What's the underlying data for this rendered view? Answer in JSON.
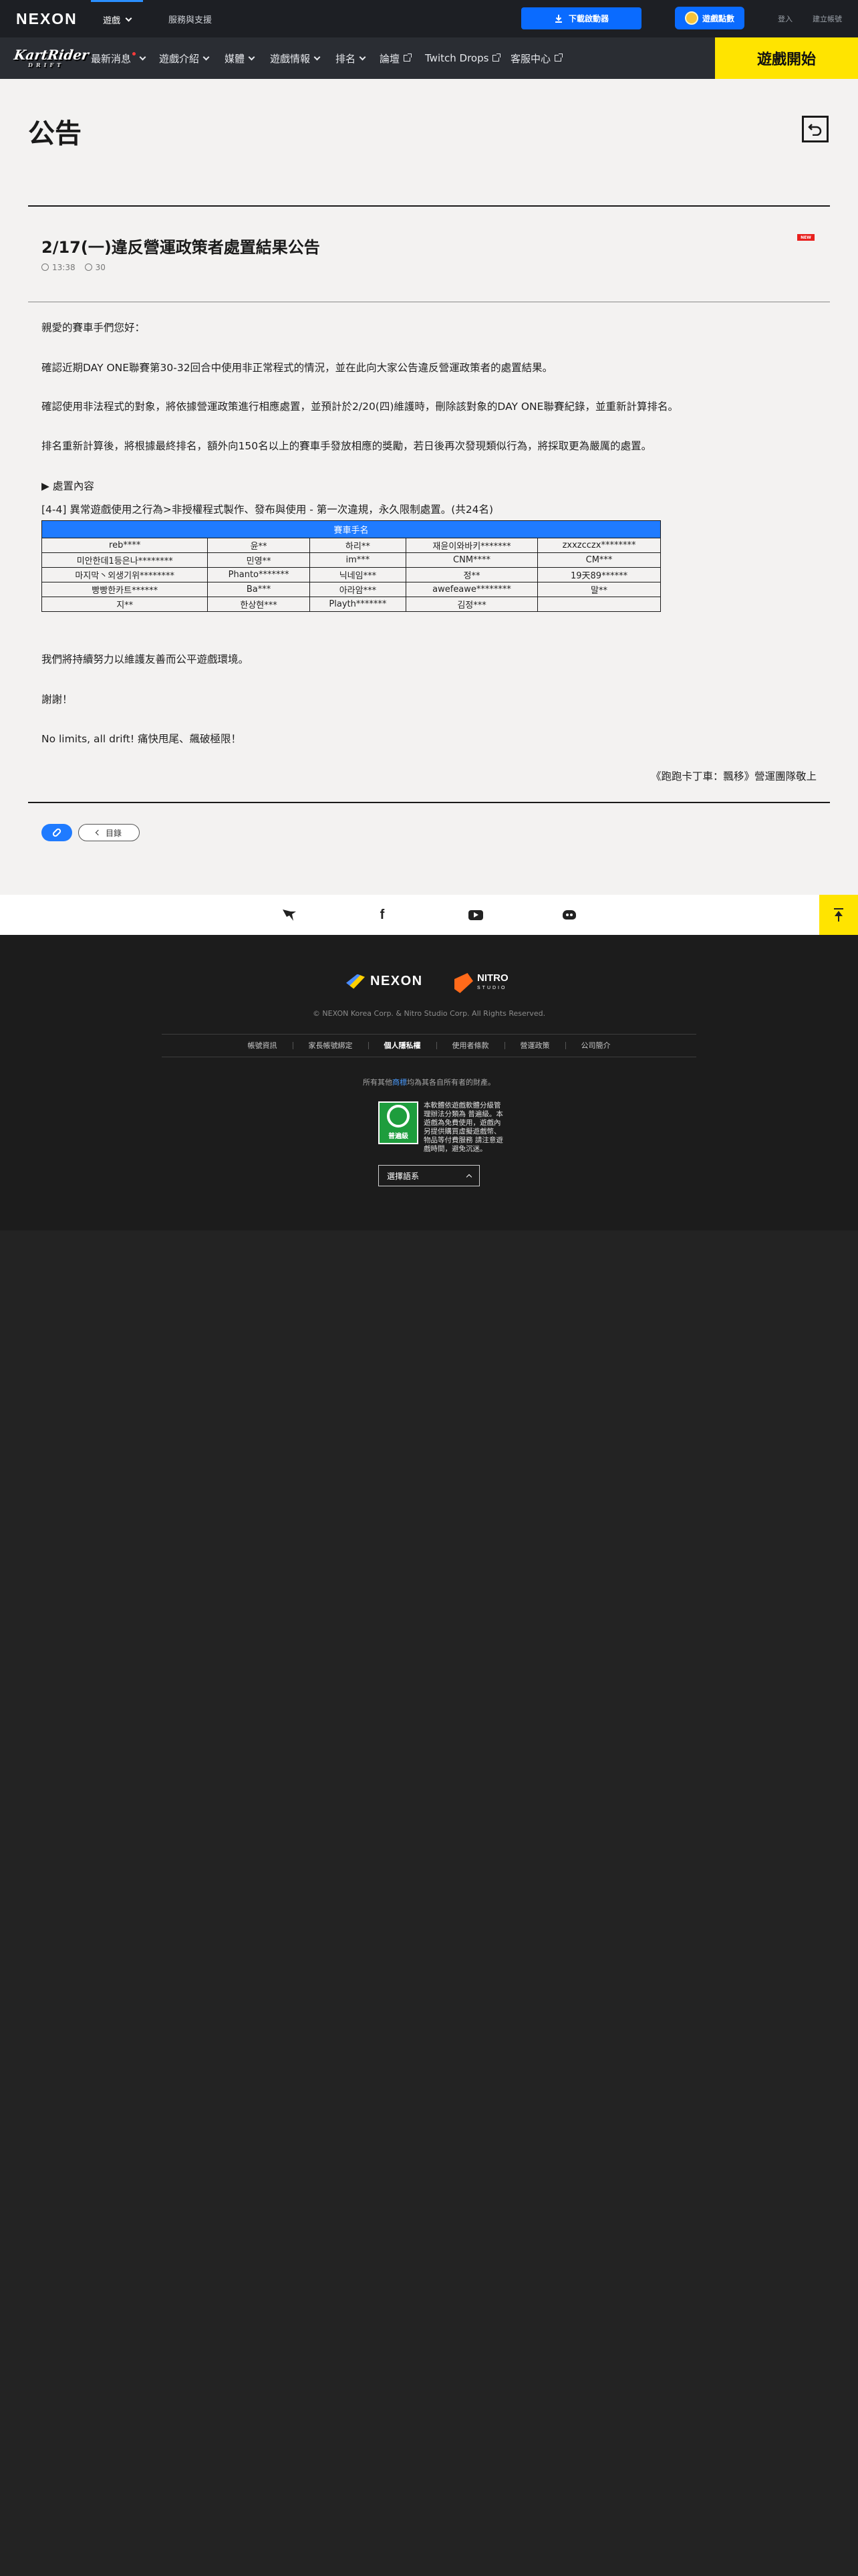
{
  "topbar": {
    "logo": "NEXON",
    "nav": [
      {
        "label": "遊戲"
      },
      {
        "label": "服務與支援"
      }
    ],
    "download_label": "下載啟動器",
    "gameplay_label": "遊戲點數",
    "login_label": "登入",
    "register_label": "建立帳號"
  },
  "gamenav": {
    "logo_main": "KartRider",
    "logo_sub": "DRIFT",
    "items": [
      {
        "label": "最新消息"
      },
      {
        "label": "遊戲介紹"
      },
      {
        "label": "媒體"
      },
      {
        "label": "遊戲情報"
      },
      {
        "label": "排名"
      },
      {
        "label": "論壇"
      },
      {
        "label": "Twitch Drops"
      },
      {
        "label": "客服中心"
      }
    ],
    "start_label": "遊戲開始"
  },
  "page": {
    "title": "公告",
    "back_icon": "return-icon"
  },
  "post": {
    "title": "2/17(一)違反營運政策者處置結果公告",
    "time": "13:38",
    "views": "30",
    "badge": "NEW",
    "greeting": "親愛的賽車手們您好：",
    "p1": "確認近期DAY ONE聯賽第30-32回合中使用非正常程式的情況，並在此向大家公告違反營運政策者的處置結果。",
    "p2": "確認使用非法程式的對象，將依據營運政策進行相應處置，並預計於2/20(四)維護時，刪除該對象的DAY ONE聯賽紀錄，並重新計算排名。",
    "p3": "排名重新計算後，將根據最終排名，額外向150名以上的賽車手發放相應的獎勵，若日後再次發現類似行為，將採取更為嚴厲的處置。",
    "section_label": "▶ 處置內容",
    "rule_line": "[4-4] 異常遊戲使用之行為>非授權程式製作、發布與使用 - 第一次違規，永久限制處置。(共24名)",
    "table": {
      "header": "賽車手名",
      "rows": [
        [
          "reb****",
          "윤**",
          "하리**",
          "재윤이와바키*******",
          "zxxzcczx********"
        ],
        [
          "미안한데1등은나********",
          "민영**",
          "im***",
          "CNM****",
          "CM***"
        ],
        [
          "마지막丶외생기위********",
          "Phanto*******",
          "닉네임***",
          "정**",
          "19天89******"
        ],
        [
          "빵빵한카트******",
          "Ba***",
          "아라암***",
          "awefeawe********",
          "말**"
        ],
        [
          "지**",
          "한상현***",
          "Playth*******",
          "김정***",
          ""
        ]
      ]
    },
    "p4": "我們將持續努力以維護友善而公平遊戲環境。",
    "thanks": "謝謝！",
    "slogan": "No limits, all drift! 痛快甩尾、飆破極限！",
    "signature": "《跑跑卡丁車：飄移》營運團隊敬上",
    "list_label": "目錄"
  },
  "footer": {
    "nexon_logo": "NEXON",
    "nitro_logo": "NITRO",
    "nitro_sub": "STUDIO",
    "copyright": "© NEXON Korea Corp. & Nitro Studio Corp. All Rights Reserved.",
    "links": [
      {
        "label": "帳號資訊"
      },
      {
        "label": "家長帳號綁定"
      },
      {
        "label": "個人隱私權"
      },
      {
        "label": "使用者條款"
      },
      {
        "label": "營運政策"
      },
      {
        "label": "公司簡介"
      }
    ],
    "trademark_prefix": "所有其他",
    "trademark_link": "商標",
    "trademark_suffix": "均為其各自所有者的財產。",
    "rating_badge": "普遍級",
    "rating_desc": "本軟體依遊戲軟體分級管理辦法分類為 普遍級。本遊戲為免費使用，遊戲內另提供購買虛擬遊戲幣、物品等付費服務 請注意遊戲時間，避免沉迷。",
    "lang_select": "選擇語系"
  }
}
